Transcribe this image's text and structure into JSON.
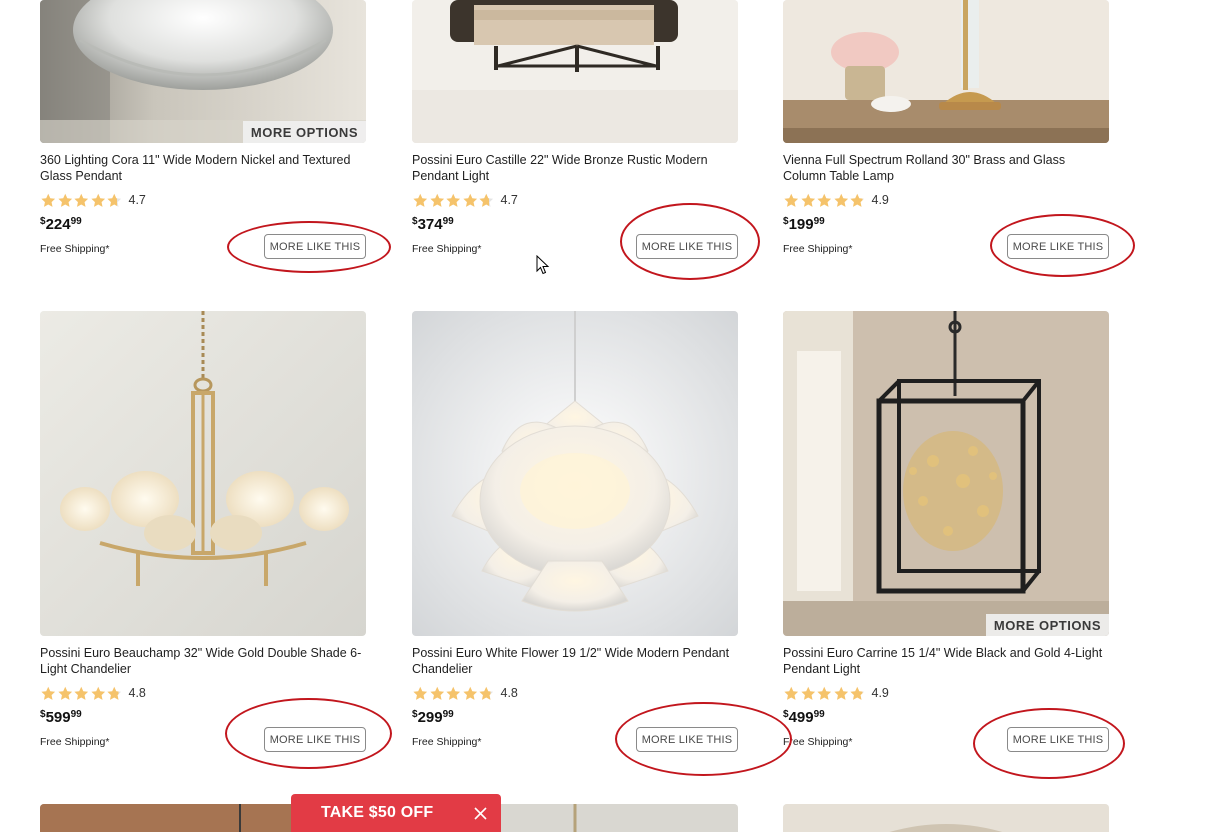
{
  "more_like_this_label": "MORE LIKE THIS",
  "more_options_label": "MORE OPTIONS",
  "products": [
    {
      "title": "360 Lighting Cora 11\" Wide Modern Nickel and Textured Glass Pendant",
      "rating": "4.7",
      "rating_value": 4.7,
      "currency": "$",
      "price_dollars": "224",
      "price_cents": "99",
      "shipping": "Free Shipping*",
      "more_options": true
    },
    {
      "title": "Possini Euro Castille 22\" Wide Bronze Rustic Modern Pendant Light",
      "rating": "4.7",
      "rating_value": 4.7,
      "currency": "$",
      "price_dollars": "374",
      "price_cents": "99",
      "shipping": "Free Shipping*",
      "more_options": false
    },
    {
      "title": "Vienna Full Spectrum Rolland 30\" Brass and Glass Column Table Lamp",
      "rating": "4.9",
      "rating_value": 4.9,
      "currency": "$",
      "price_dollars": "199",
      "price_cents": "99",
      "shipping": "Free Shipping*",
      "more_options": false
    },
    {
      "title": "Possini Euro Beauchamp 32\" Wide Gold Double Shade 6-Light Chandelier",
      "rating": "4.8",
      "rating_value": 4.8,
      "currency": "$",
      "price_dollars": "599",
      "price_cents": "99",
      "shipping": "Free Shipping*",
      "more_options": false
    },
    {
      "title": "Possini Euro White Flower 19 1/2\" Wide Modern Pendant Chandelier",
      "rating": "4.8",
      "rating_value": 4.8,
      "currency": "$",
      "price_dollars": "299",
      "price_cents": "99",
      "shipping": "Free Shipping*",
      "more_options": false
    },
    {
      "title": "Possini Euro Carrine 15 1/4\" Wide Black and Gold 4-Light Pendant Light",
      "rating": "4.9",
      "rating_value": 4.9,
      "currency": "$",
      "price_dollars": "499",
      "price_cents": "99",
      "shipping": "Free Shipping*",
      "more_options": true
    }
  ],
  "promo": {
    "label": "TAKE $50 OFF"
  },
  "colors": {
    "star": "#f5c36b",
    "star_empty": "#e4e4e4",
    "promo_bg": "#e23b45",
    "annotation": "#c2161d"
  },
  "icons": {
    "star": "star-icon",
    "close": "close-icon",
    "cursor": "mouse-cursor-icon"
  }
}
